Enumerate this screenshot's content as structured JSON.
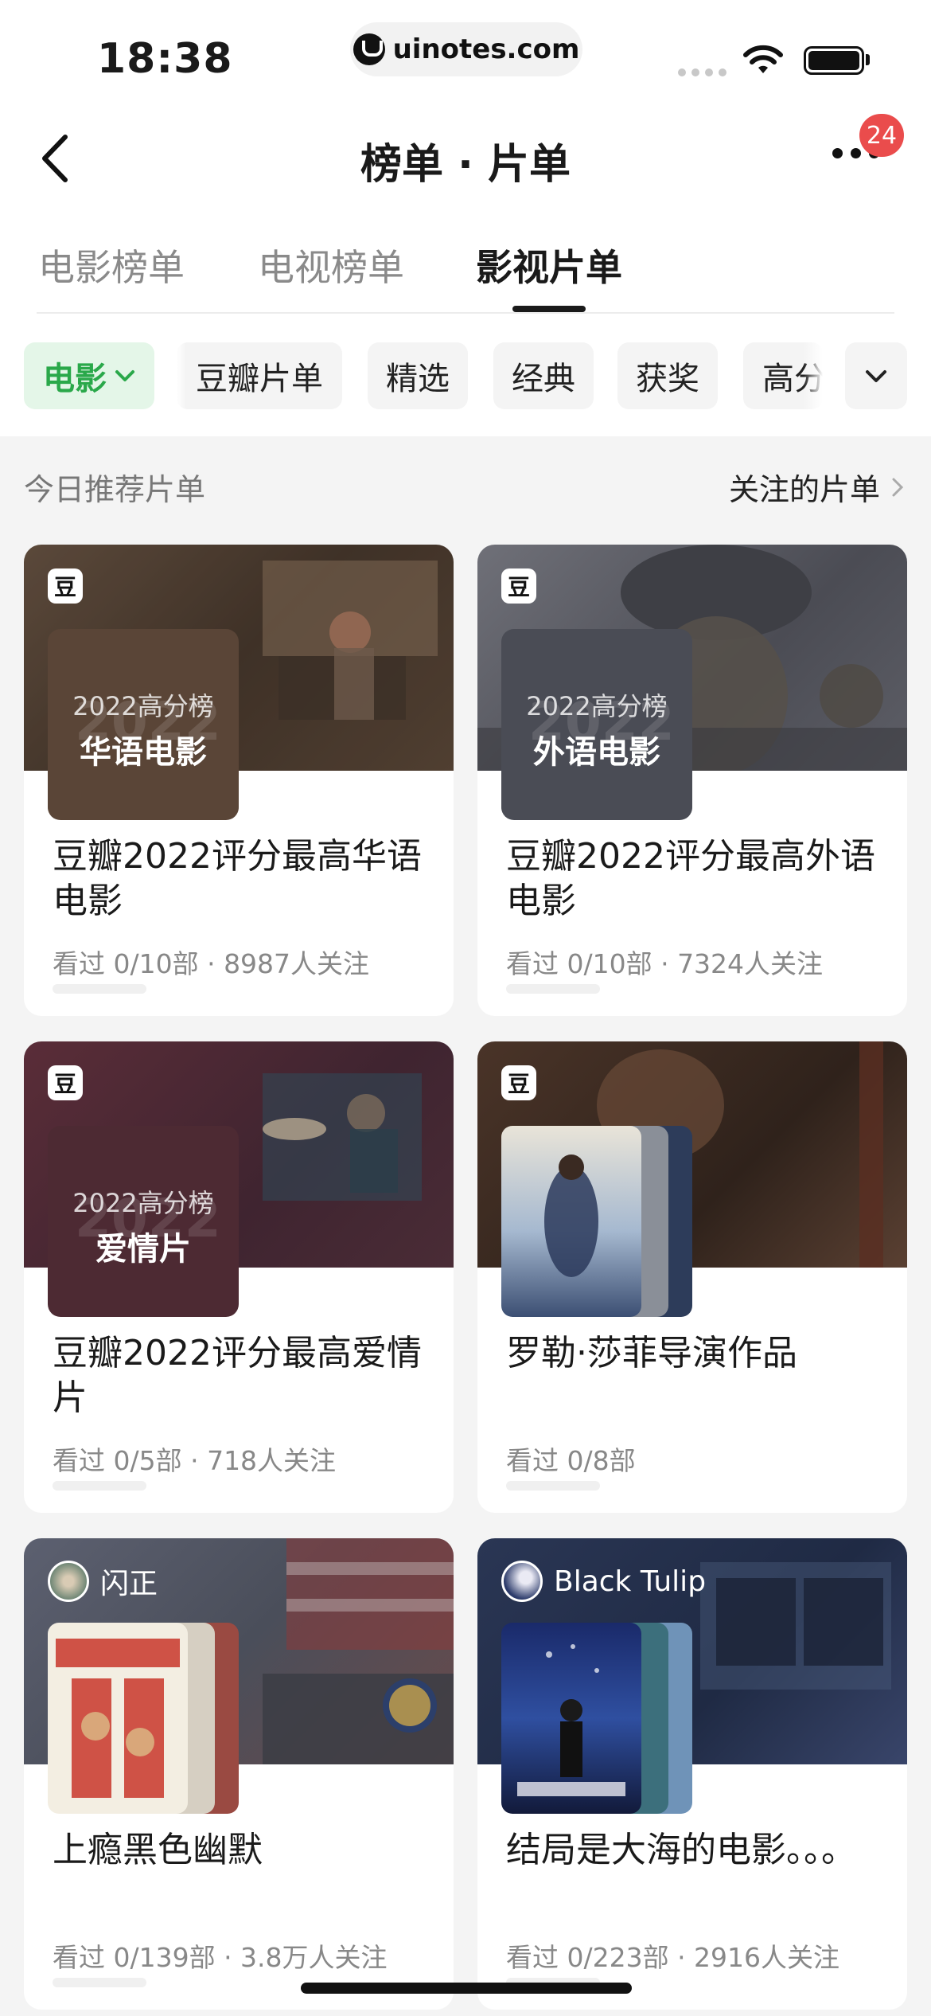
{
  "status_bar": {
    "time": "18:38",
    "url": "uinotes.com"
  },
  "nav": {
    "title": "榜单 · 片单",
    "badge_count": "24"
  },
  "tabs": [
    {
      "label": "电影榜单"
    },
    {
      "label": "电视榜单"
    },
    {
      "label": "影视片单",
      "active": true
    }
  ],
  "filters": {
    "category": "电影",
    "chips": [
      "豆瓣片单",
      "精选",
      "经典",
      "获奖",
      "高分"
    ]
  },
  "section": {
    "title": "今日推荐片单",
    "link": "关注的片单"
  },
  "cards": [
    {
      "badge": "豆",
      "cover_year": "2022",
      "cover_sub": "2022高分榜",
      "cover_main": "华语电影",
      "title": "豆瓣2022评分最高华语电影",
      "meta": "看过  0/10部  · 8987人关注",
      "theme_color": "#5a4537"
    },
    {
      "badge": "豆",
      "cover_year": "2022",
      "cover_sub": "2022高分榜",
      "cover_main": "外语电影",
      "title": "豆瓣2022评分最高外语电影",
      "meta": "看过  0/10部  · 7324人关注",
      "theme_color": "#4a4c55"
    },
    {
      "badge": "豆",
      "cover_year": "2022",
      "cover_sub": "2022高分榜",
      "cover_main": "爱情片",
      "title": "豆瓣2022评分最高爱情片",
      "meta": "看过  0/5部  · 718人关注",
      "theme_color": "#4d2a33"
    },
    {
      "badge": "豆",
      "title": "罗勒·莎菲导演作品",
      "meta": "看过  0/8部",
      "theme_color": "#3a2a22"
    },
    {
      "author": "闪正",
      "title": "上瘾黑色幽默",
      "meta": "看过  0/139部  · 3.8万人关注",
      "theme_color": "#4a4e5a"
    },
    {
      "author": "Black Tulip",
      "title": "结局是大海的电影。。。",
      "meta": "看过  0/223部  · 2916人关注",
      "theme_color": "#1f2a44"
    }
  ]
}
